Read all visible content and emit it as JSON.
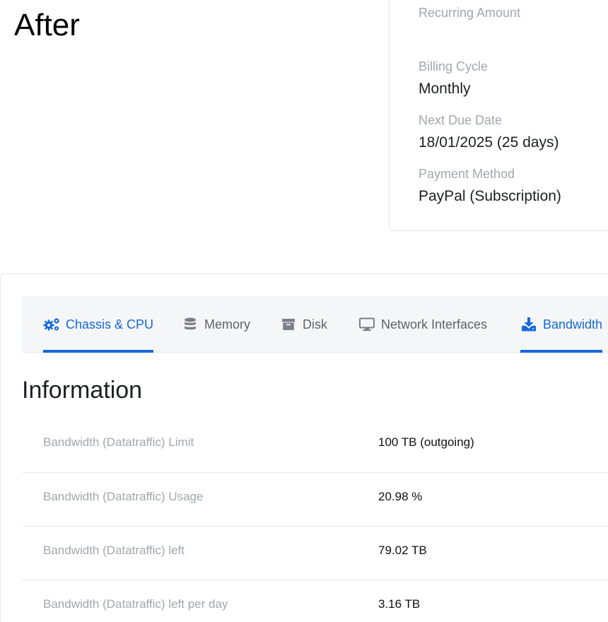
{
  "heading": "After",
  "billing": {
    "recurring_amount_label": "Recurring Amount",
    "billing_cycle_label": "Billing Cycle",
    "billing_cycle_value": "Monthly",
    "next_due_date_label": "Next Due Date",
    "next_due_date_value": "18/01/2025 (25 days)",
    "payment_method_label": "Payment Method",
    "payment_method_value": "PayPal (Subscription)"
  },
  "tabs": [
    {
      "label": "Chassis & CPU",
      "icon": "cogs-icon",
      "active": true
    },
    {
      "label": "Memory",
      "icon": "database-icon",
      "active": false
    },
    {
      "label": "Disk",
      "icon": "archive-icon",
      "active": false
    },
    {
      "label": "Network Interfaces",
      "icon": "monitor-icon",
      "active": false
    },
    {
      "label": "Bandwidth",
      "icon": "download-icon",
      "active": true
    }
  ],
  "accent_color": "#1668dc",
  "section": {
    "title": "Information",
    "rows": [
      {
        "label": "Bandwidth (Datatraffic) Limit",
        "value": "100 TB (outgoing)"
      },
      {
        "label": "Bandwidth (Datatraffic) Usage",
        "value": "20.98 %"
      },
      {
        "label": "Bandwidth (Datatraffic) left",
        "value": "79.02 TB"
      },
      {
        "label": "Bandwidth (Datatraffic) left per day",
        "value": "3.16 TB"
      }
    ]
  }
}
